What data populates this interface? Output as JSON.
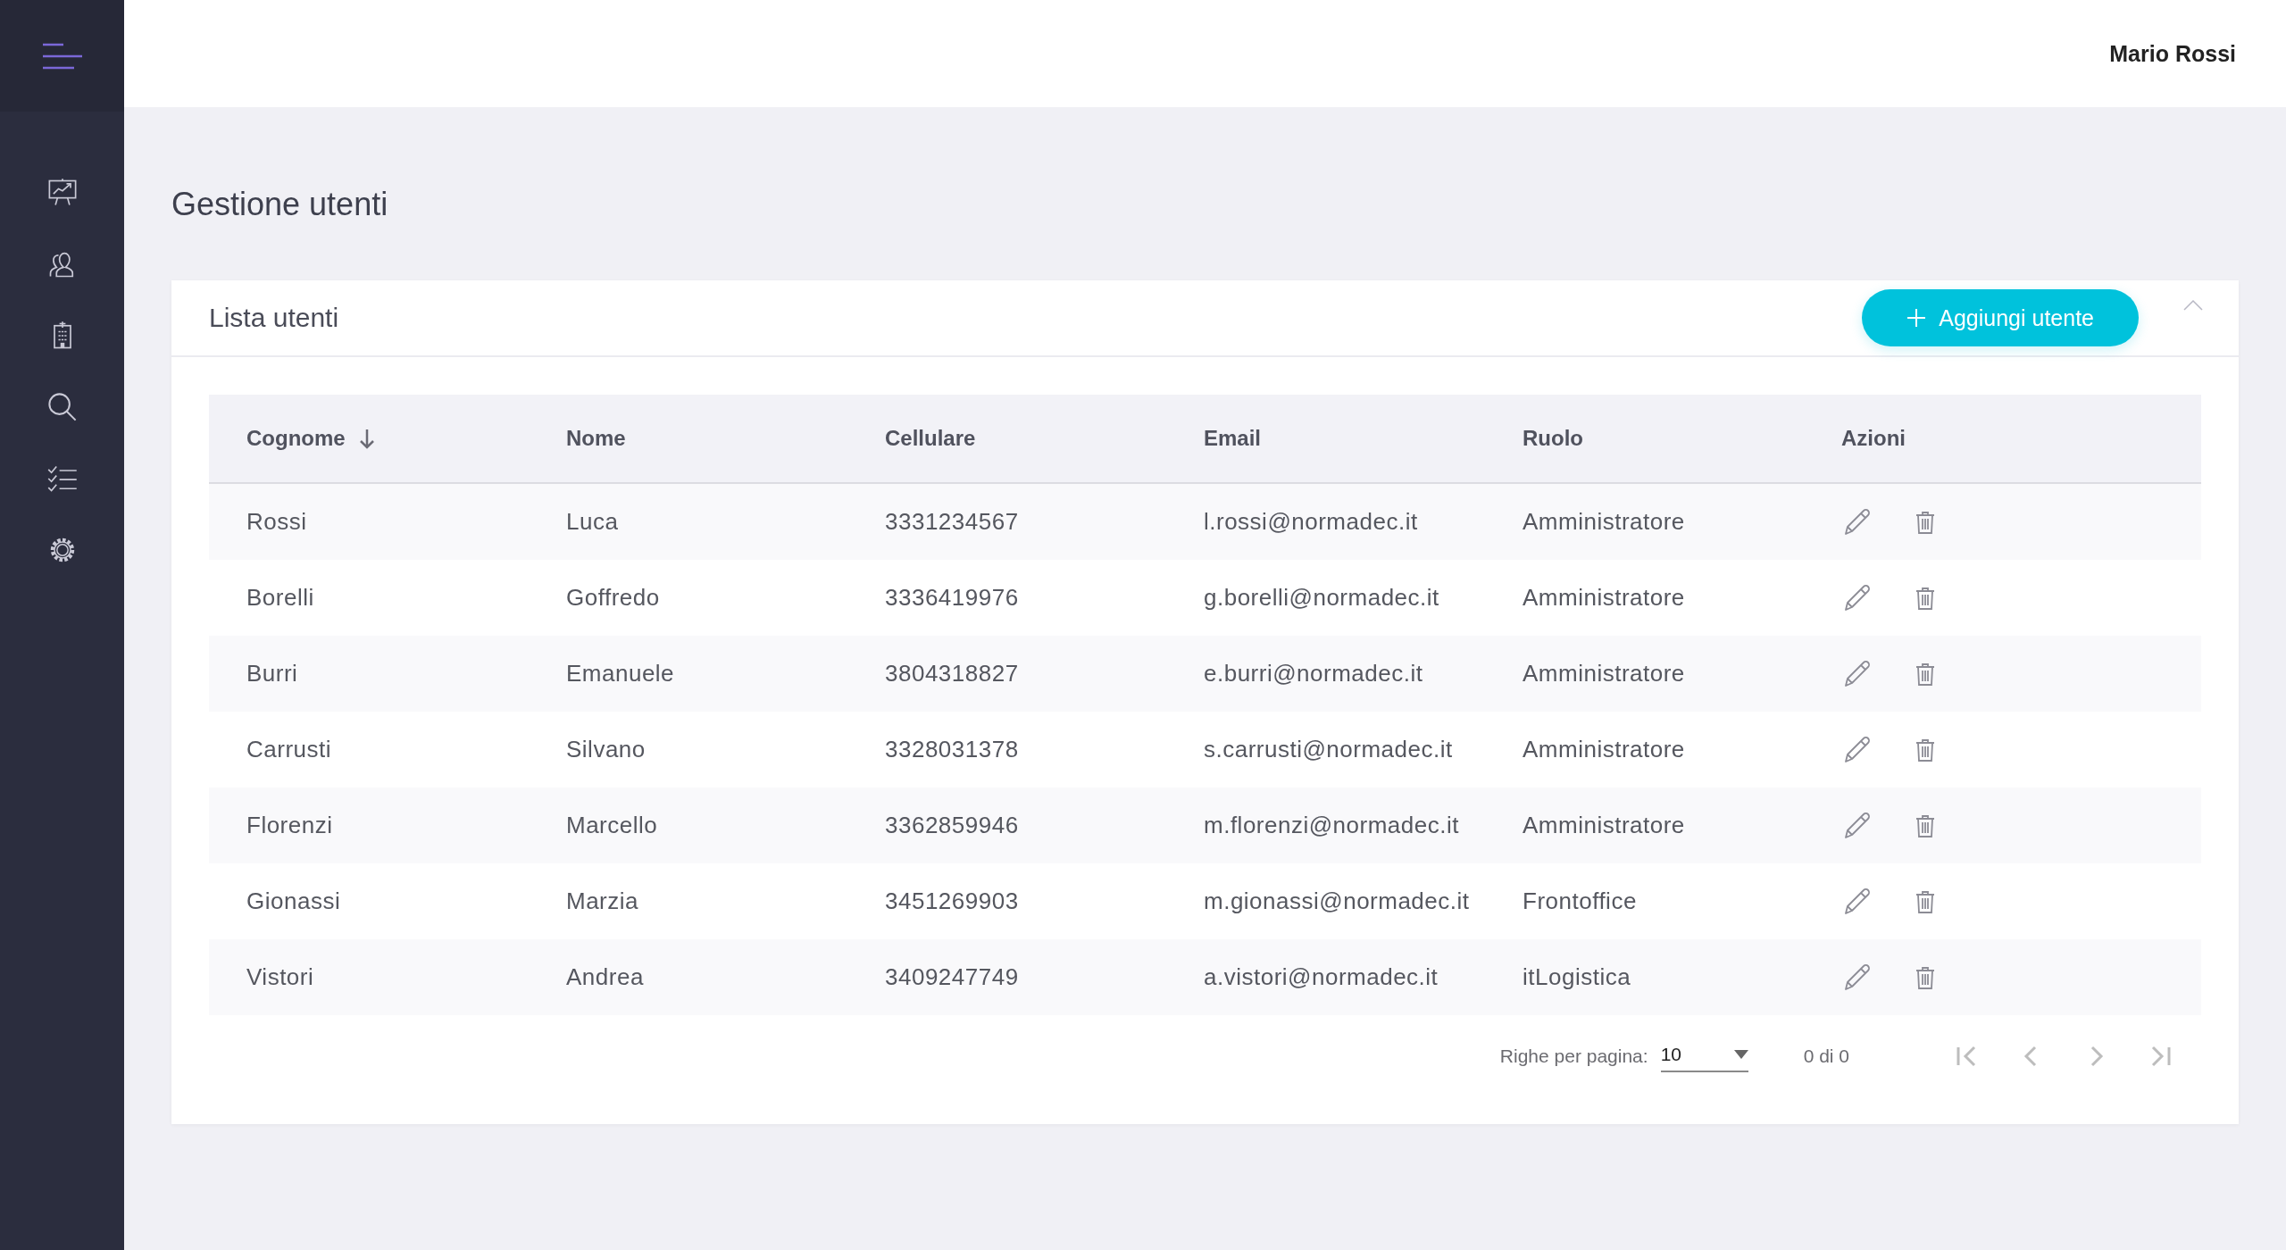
{
  "sidebar": {
    "items": [
      {
        "kind": "dashboard"
      },
      {
        "kind": "users"
      },
      {
        "kind": "building"
      },
      {
        "kind": "search"
      },
      {
        "kind": "checklist"
      },
      {
        "kind": "settings"
      }
    ]
  },
  "header": {
    "user_name": "Mario Rossi"
  },
  "page_title": "Gestione utenti",
  "card": {
    "title": "Lista utenti",
    "add_button": "Aggiungi utente",
    "table": {
      "columns": [
        {
          "label": "Cognome",
          "sorted": true
        },
        {
          "label": "Nome",
          "sorted": false
        },
        {
          "label": "Cellulare",
          "sorted": false
        },
        {
          "label": "Email",
          "sorted": false
        },
        {
          "label": "Ruolo",
          "sorted": false
        },
        {
          "label": "Azioni",
          "sorted": false
        }
      ],
      "rows": [
        [
          "Rossi",
          "Luca",
          "3331234567",
          "l.rossi@normadec.it",
          "Amministratore"
        ],
        [
          "Borelli",
          "Goffredo",
          "3336419976",
          "g.borelli@normadec.it",
          "Amministratore"
        ],
        [
          "Burri",
          "Emanuele",
          "3804318827",
          "e.burri@normadec.it",
          "Amministratore"
        ],
        [
          "Carrusti",
          "Silvano",
          "3328031378",
          "s.carrusti@normadec.it",
          "Amministratore"
        ],
        [
          "Florenzi",
          "Marcello",
          "3362859946",
          "m.florenzi@normadec.it",
          "Amministratore"
        ],
        [
          "Gionassi",
          "Marzia",
          "3451269903",
          "m.gionassi@normadec.it",
          "Frontoffice"
        ],
        [
          "Vistori",
          "Andrea",
          "3409247749",
          "a.vistori@normadec.it",
          "itLogistica"
        ]
      ]
    },
    "pagination": {
      "rows_per_page_label": "Righe per pagina:",
      "rows_per_page": "10",
      "range": "0 di 0"
    }
  }
}
